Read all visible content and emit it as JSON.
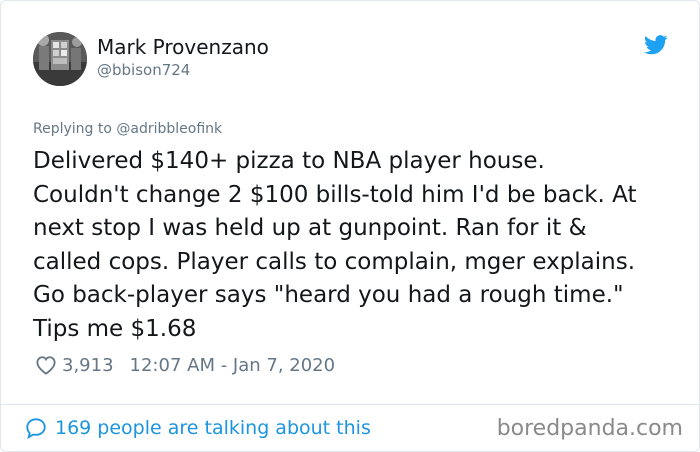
{
  "author": {
    "display_name": "Mark Provenzano",
    "handle": "@bbison724",
    "avatar_icon": "profile-photo"
  },
  "platform_icon": "twitter-bird-icon",
  "accent_color": "#1da1f2",
  "reply": {
    "label": "Replying to @adribbleofink"
  },
  "tweet": {
    "lines": [
      "Delivered $140+ pizza to NBA player house.",
      "Couldn't change 2 $100 bills-told him I'd be back. At",
      "next stop I was held up at gunpoint. Ran for it &",
      "called cops. Player calls to complain, mger explains.",
      "Go back-player says \"heard you had a rough time.\"",
      "Tips me $1.68"
    ]
  },
  "stats": {
    "likes": "3,913",
    "timestamp": "12:07 AM - Jan 7, 2020"
  },
  "footer": {
    "talking_label": "169 people are talking about this",
    "watermark": "boredpanda.com"
  }
}
